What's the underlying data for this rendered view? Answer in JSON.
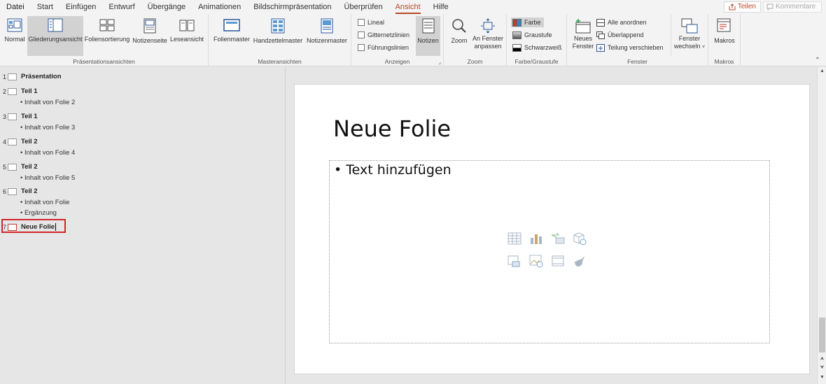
{
  "menu": {
    "tabs": [
      "Datei",
      "Start",
      "Einfügen",
      "Entwurf",
      "Übergänge",
      "Animationen",
      "Bildschirmpräsentation",
      "Überprüfen",
      "Ansicht",
      "Hilfe"
    ],
    "active": "Ansicht",
    "share_label": "Teilen",
    "comments_label": "Kommentare"
  },
  "ribbon": {
    "presentation_views": {
      "label": "Präsentationsansichten",
      "buttons": [
        "Normal",
        "Gliederungsansicht",
        "Foliensortierung",
        "Notizenseite",
        "Leseansicht"
      ],
      "selected": "Gliederungsansicht"
    },
    "master_views": {
      "label": "Masteransichten",
      "buttons": [
        "Folienmaster",
        "Handzettelmaster",
        "Notizenmaster"
      ]
    },
    "show": {
      "label": "Anzeigen",
      "checkboxes": [
        "Lineal",
        "Gitternetzlinien",
        "Führungslinien"
      ],
      "notes_label": "Notizen"
    },
    "zoom": {
      "label": "Zoom",
      "zoom_label": "Zoom",
      "fit_label_1": "An Fenster",
      "fit_label_2": "anpassen"
    },
    "color": {
      "label": "Farbe/Graustufe",
      "options": [
        "Farbe",
        "Graustufe",
        "Schwarzweiß"
      ],
      "selected": "Farbe"
    },
    "window": {
      "label": "Fenster",
      "new_window_1": "Neues",
      "new_window_2": "Fenster",
      "arrange_all": "Alle anordnen",
      "cascade": "Überlappend",
      "move_split": "Teilung verschieben",
      "switch_1": "Fenster",
      "switch_2": "wechseln"
    },
    "macros": {
      "label": "Makros",
      "button": "Makros"
    }
  },
  "outline": {
    "slides": [
      {
        "num": "1",
        "title": "Präsentation",
        "bullets": []
      },
      {
        "num": "2",
        "title": "Teil 1",
        "bullets": [
          "• Inhalt von Folie 2"
        ]
      },
      {
        "num": "3",
        "title": "Teil 1",
        "bullets": [
          "• Inhalt von Folie 3"
        ]
      },
      {
        "num": "4",
        "title": "Teil 2",
        "bullets": [
          "• Inhalt von Folie 4"
        ]
      },
      {
        "num": "5",
        "title": "Teil 2",
        "bullets": [
          "• Inhalt von Folie 5"
        ]
      },
      {
        "num": "6",
        "title": "Teil 2",
        "bullets": [
          "• Inhalt von Folie",
          "• Ergänzung"
        ]
      },
      {
        "num": "7",
        "title": "Neue Folie",
        "bullets": []
      }
    ]
  },
  "slide": {
    "title": "Neue Folie",
    "placeholder_text": "• Text hinzufügen",
    "placeholder_icons": [
      "table-icon",
      "chart-icon",
      "smartart-icon",
      "3d-model-icon",
      "picture-icon",
      "online-picture-icon",
      "video-icon",
      "icons-icon"
    ]
  },
  "colors": {
    "accent": "#b7472a",
    "selection_red": "#d0262b"
  }
}
